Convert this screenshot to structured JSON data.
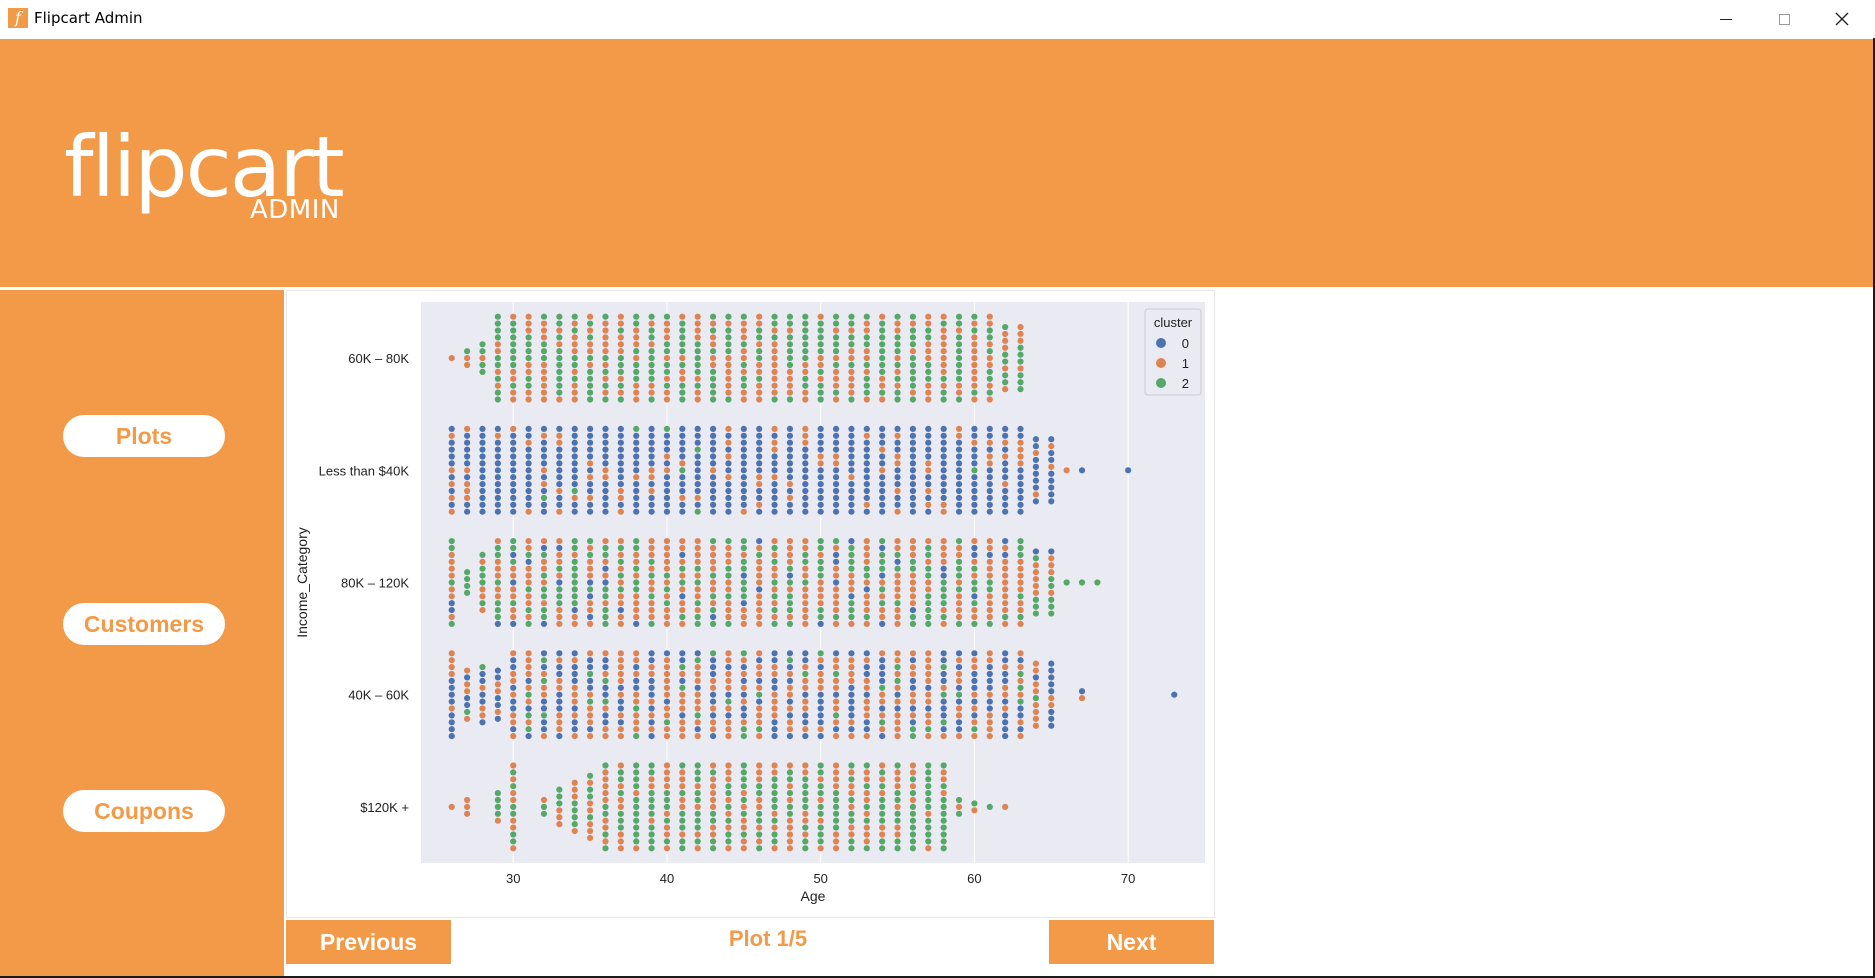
{
  "window": {
    "title": "Flipcart Admin",
    "icon_letter": "f"
  },
  "header": {
    "logo_main": "flipcart",
    "logo_sub": "ADMIN"
  },
  "sidebar": {
    "items": [
      {
        "label": "Plots"
      },
      {
        "label": "Customers"
      },
      {
        "label": "Coupons"
      }
    ]
  },
  "plot_nav": {
    "previous_label": "Previous",
    "next_label": "Next",
    "counter": "Plot 1/5"
  },
  "colors": {
    "accent": "#f29a48",
    "plot_bg": "#eaeaf2",
    "cluster_0": "#4c72b0",
    "cluster_1": "#dd8452",
    "cluster_2": "#55a868"
  },
  "chart_data": {
    "type": "scatter",
    "subtype": "swarm",
    "xlabel": "Age",
    "ylabel": "Income_Category",
    "xlim": [
      24,
      75
    ],
    "xticks": [
      30,
      40,
      50,
      60,
      70
    ],
    "categories": [
      "$60K - $80K",
      "Less than $40K",
      "$80K - $120K",
      "$40K - $60K",
      "$120K +"
    ],
    "category_tick_labels": [
      "60K – 80K",
      "Less than $40K",
      "80K – 120K",
      "40K – 60K",
      "$120K +"
    ],
    "grid": true,
    "legend": {
      "title": "cluster",
      "entries": [
        "0",
        "1",
        "2"
      ],
      "placement": "top-right"
    },
    "series": [
      {
        "name": "0",
        "color": "#4c72b0"
      },
      {
        "name": "1",
        "color": "#dd8452"
      },
      {
        "name": "2",
        "color": "#55a868"
      }
    ],
    "rows": [
      {
        "category": "$60K - $80K",
        "age_min": 26,
        "age_max": 63,
        "sparse_ages": [
          26,
          27,
          28,
          29,
          30
        ],
        "mix": [
          0.0,
          0.5,
          0.5
        ],
        "height": 0.85
      },
      {
        "category": "Less than $40K",
        "age_min": 26,
        "age_max": 65,
        "extra_ages": [
          66,
          67,
          70
        ],
        "mix": [
          0.78,
          0.2,
          0.02
        ],
        "height": 0.85
      },
      {
        "category": "$80K - $120K",
        "age_min": 26,
        "age_max": 65,
        "extra_ages": [
          66,
          67,
          68
        ],
        "mix": [
          0.1,
          0.55,
          0.35
        ],
        "height": 0.85
      },
      {
        "category": "$40K - $60K",
        "age_min": 26,
        "age_max": 65,
        "extra_ages": [
          67,
          73
        ],
        "mix": [
          0.45,
          0.45,
          0.1
        ],
        "height": 0.85
      },
      {
        "category": "$120K +",
        "age_min": 32,
        "age_max": 58,
        "sparse_ages": [
          26,
          27,
          29,
          30,
          59,
          60,
          61,
          62
        ],
        "mix": [
          0.0,
          0.45,
          0.55
        ],
        "height": 0.85
      }
    ]
  }
}
